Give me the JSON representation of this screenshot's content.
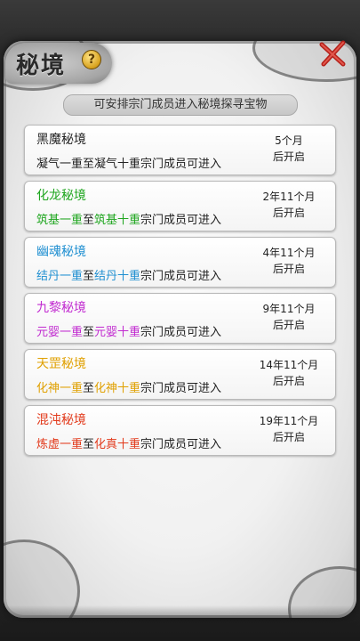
{
  "header": {
    "title": "秘境",
    "help_symbol": "?",
    "subtitle": "可安排宗门成员进入秘境探寻宝物"
  },
  "realms": [
    {
      "name": "黑魔秘境",
      "color": "#222222",
      "from": "凝气一重",
      "to": "凝气十重",
      "connector": "至",
      "suffix": "宗门成员可进入",
      "time_line1": "5个月",
      "time_line2": "后开启"
    },
    {
      "name": "化龙秘境",
      "color": "#1fa61f",
      "from": "筑基一重",
      "to": "筑基十重",
      "connector": "至",
      "suffix": "宗门成员可进入",
      "time_line1": "2年11个月",
      "time_line2": "后开启"
    },
    {
      "name": "幽魂秘境",
      "color": "#1f8fd1",
      "from": "结丹一重",
      "to": "结丹十重",
      "connector": "至",
      "suffix": "宗门成员可进入",
      "time_line1": "4年11个月",
      "time_line2": "后开启"
    },
    {
      "name": "九黎秘境",
      "color": "#c12ad0",
      "from": "元婴一重",
      "to": "元婴十重",
      "connector": "至",
      "suffix": "宗门成员可进入",
      "time_line1": "9年11个月",
      "time_line2": "后开启"
    },
    {
      "name": "天罡秘境",
      "color": "#e0a000",
      "from": "化神一重",
      "to": "化神十重",
      "connector": "至",
      "suffix": "宗门成员可进入",
      "time_line1": "14年11个月",
      "time_line2": "后开启"
    },
    {
      "name": "混沌秘境",
      "color": "#e23a1c",
      "from": "炼虚一重",
      "to": "化真十重",
      "connector": "至",
      "suffix": "宗门成员可进入",
      "time_line1": "19年11个月",
      "time_line2": "后开启"
    }
  ]
}
